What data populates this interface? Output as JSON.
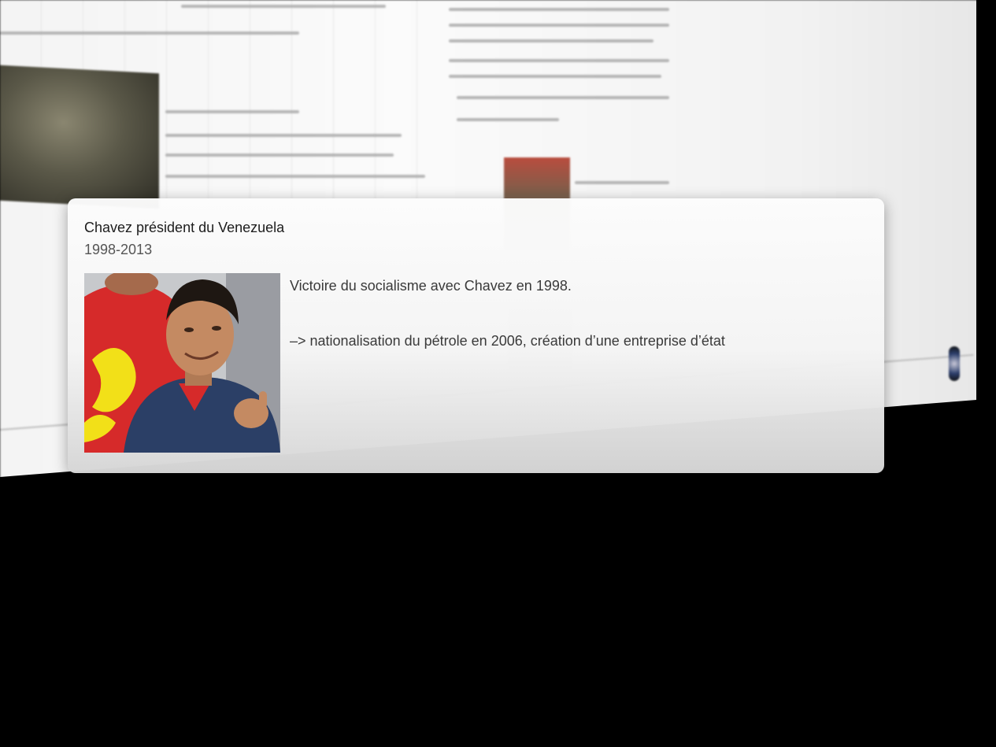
{
  "event": {
    "title": "Chavez président du Venezuela",
    "dates": "1998-2013",
    "image_icon": "portrait-photo",
    "paragraphs": [
      "Victoire du socialisme avec Chavez en 1998.",
      "–> nationalisation du pétrole en 2006, création d’une entreprise d’état"
    ]
  },
  "colors": {
    "background": "#000000",
    "card_text": "#1c1c1c",
    "card_subtext": "#555555",
    "photo_shirt_red": "#d62a2a",
    "photo_jacket_blue": "#2b3f66"
  }
}
